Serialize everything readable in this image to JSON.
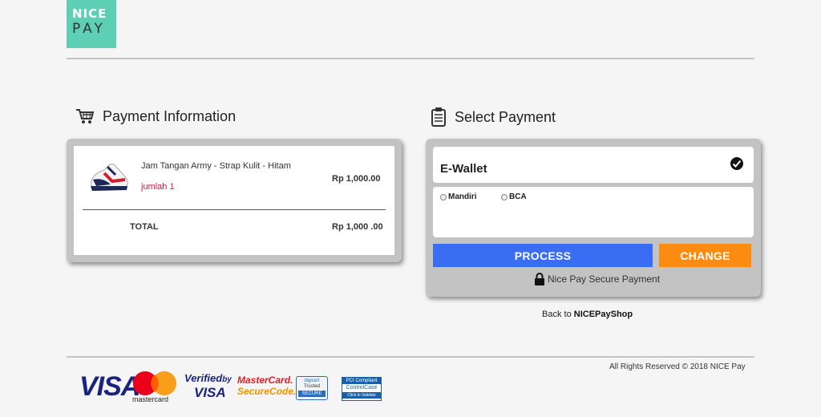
{
  "logo": {
    "line1": "NICE",
    "line2": "PAY"
  },
  "payment_info": {
    "title": "Payment Information",
    "product": {
      "name": "Jam Tangan Army - Strap Kulit - Hitam",
      "qty_label": "jumlah 1",
      "price": "Rp 1,000.00"
    },
    "total_label": "TOTAL",
    "total_value": "Rp 1,000 .00"
  },
  "select_payment": {
    "title": "Select Payment",
    "method": "E-Wallet",
    "options": [
      "Mandiri",
      "BCA"
    ],
    "process_label": "PROCESS",
    "change_label": "CHANGE",
    "secure_label": "Nice Pay Secure Payment"
  },
  "back": {
    "prefix": "Back to ",
    "link": "NICEPayShop"
  },
  "footer": {
    "copyright": "All Rights Reserved © 2018 NICE Pay",
    "badges": {
      "visa": "VISA",
      "mastercard": "mastercard",
      "verified_line1": "Verified",
      "verified_line2": "by",
      "verified_line3": "VISA",
      "securecode_line1": "MasterCard.",
      "securecode_line2": "SecureCode.",
      "digicert_line1": "digicert",
      "digicert_line2": "Trusted",
      "digicert_line3": "SECURE",
      "pci_line1": "PCI Compliant",
      "pci_line2": "ControlCase",
      "pci_line3": "Click to Validate"
    }
  },
  "colors": {
    "brand": "#5ccfb5",
    "process": "#3a6cf4",
    "change": "#fb8c11",
    "qty": "#e0163c"
  }
}
